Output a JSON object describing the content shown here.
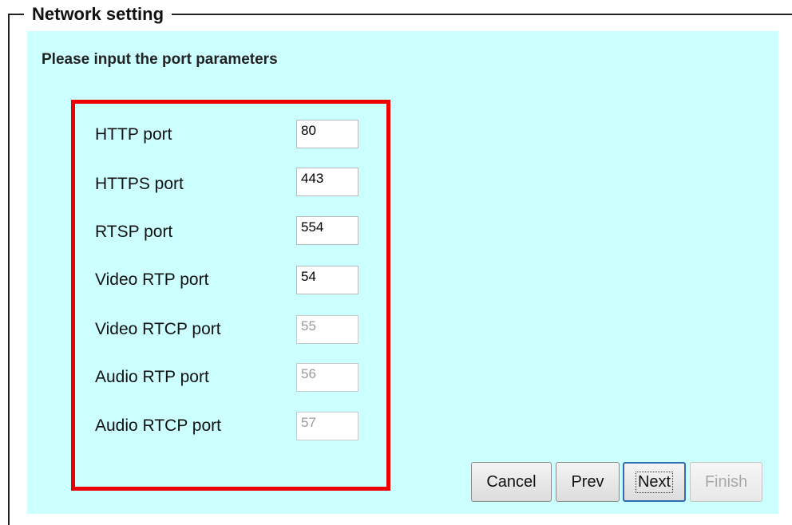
{
  "fieldset": {
    "legend": "Network setting"
  },
  "panel": {
    "heading": "Please input the port parameters"
  },
  "ports": [
    {
      "label": "HTTP port",
      "value": "80",
      "enabled": true
    },
    {
      "label": "HTTPS port",
      "value": "443",
      "enabled": true
    },
    {
      "label": "RTSP port",
      "value": "554",
      "enabled": true
    },
    {
      "label": "Video RTP port",
      "value": "54",
      "enabled": true
    },
    {
      "label": "Video RTCP port",
      "value": "55",
      "enabled": false
    },
    {
      "label": "Audio RTP port",
      "value": "56",
      "enabled": false
    },
    {
      "label": "Audio RTCP port",
      "value": "57",
      "enabled": false
    }
  ],
  "buttons": {
    "cancel": "Cancel",
    "prev": "Prev",
    "next": "Next",
    "finish": "Finish"
  },
  "colors": {
    "panel_background": "#ccffff",
    "highlight_border": "#ee0000"
  }
}
